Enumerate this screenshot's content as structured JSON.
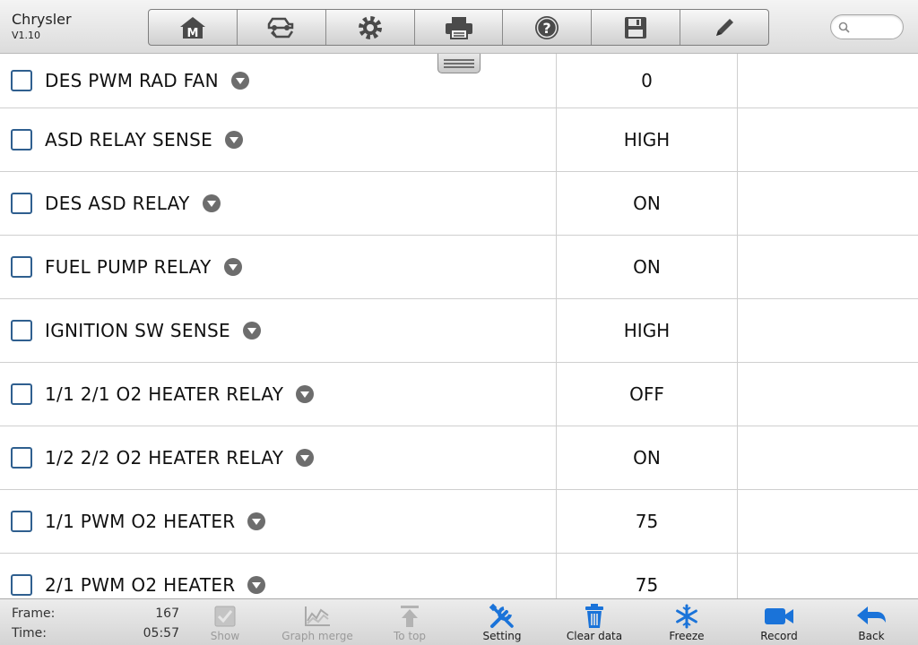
{
  "app": {
    "title": "Chrysler",
    "version": "V1.10"
  },
  "toolbar": {
    "buttons": [
      {
        "name": "home",
        "icon": "home-icon"
      },
      {
        "name": "vehicle-swap",
        "icon": "vehicle-swap-icon"
      },
      {
        "name": "settings",
        "icon": "gear-icon"
      },
      {
        "name": "print",
        "icon": "printer-icon"
      },
      {
        "name": "help",
        "icon": "help-icon"
      },
      {
        "name": "save",
        "icon": "save-icon"
      },
      {
        "name": "edit",
        "icon": "pencil-icon"
      }
    ]
  },
  "search": {
    "value": "",
    "placeholder": ""
  },
  "rows": [
    {
      "name": "DES PWM RAD FAN",
      "value": "0",
      "unit": ""
    },
    {
      "name": "ASD RELAY SENSE",
      "value": "HIGH",
      "unit": ""
    },
    {
      "name": "DES ASD RELAY",
      "value": "ON",
      "unit": ""
    },
    {
      "name": "FUEL PUMP RELAY",
      "value": "ON",
      "unit": ""
    },
    {
      "name": "IGNITION SW SENSE",
      "value": "HIGH",
      "unit": ""
    },
    {
      "name": "1/1 2/1 O2 HEATER RELAY",
      "value": "OFF",
      "unit": ""
    },
    {
      "name": "1/2 2/2 O2 HEATER RELAY",
      "value": "ON",
      "unit": ""
    },
    {
      "name": "1/1 PWM O2 HEATER",
      "value": "75",
      "unit": ""
    },
    {
      "name": "2/1 PWM O2 HEATER",
      "value": "75",
      "unit": ""
    }
  ],
  "status": {
    "frame_label": "Frame:",
    "frame_value": "167",
    "time_label": "Time:",
    "time_value": "05:57"
  },
  "bottom_buttons": {
    "show": "Show",
    "graph_merge": "Graph merge",
    "to_top": "To top",
    "setting": "Setting",
    "clear_data": "Clear data",
    "freeze": "Freeze",
    "record": "Record",
    "back": "Back"
  },
  "colors": {
    "accent": "#1a73d9",
    "disabled": "#9a9a9a",
    "checkbox_border": "#2f5f8f"
  }
}
